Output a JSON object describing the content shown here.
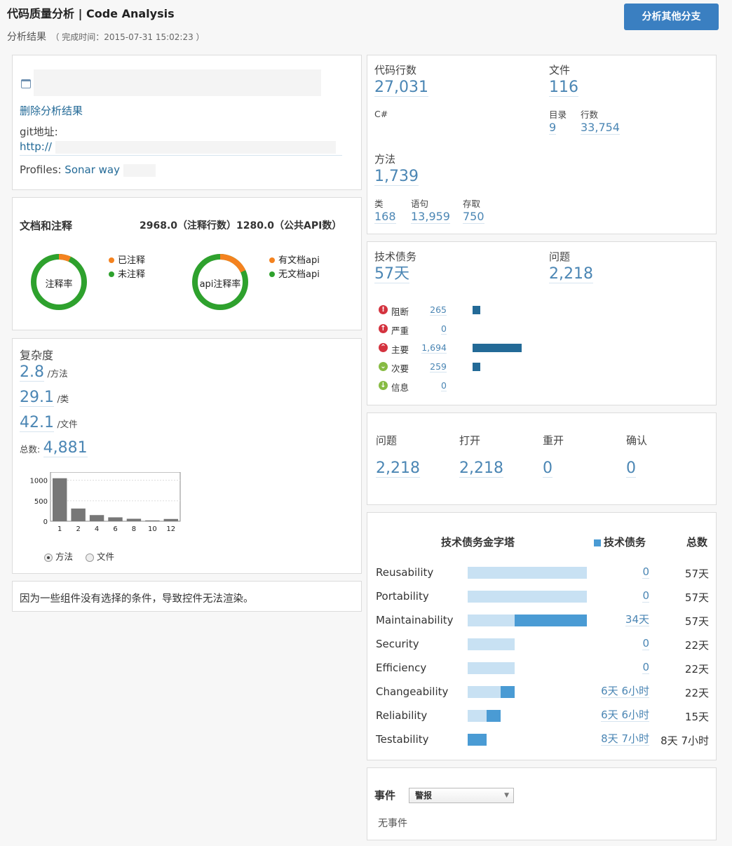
{
  "header": {
    "title": "代码质量分析 | Code Analysis",
    "subtitle": "分析结果",
    "completed": "（ 完成时间：2015-07-31 15:02:23 ）",
    "branch_button": "分析其他分支"
  },
  "project": {
    "delete_link": "删除分析结果",
    "git_label": "git地址:",
    "git_url": "http://",
    "profiles_label": "Profiles:",
    "profile_name": "Sonar way"
  },
  "docs": {
    "title": "文档和注释",
    "summary": "2968.0（注释行数）1280.0（公共API数）",
    "donut1": {
      "center": "注释率",
      "legend": [
        "已注释",
        "未注释"
      ],
      "fraction": 0.07
    },
    "donut2": {
      "center": "api注释率",
      "legend": [
        "有文档api",
        "无文档api"
      ],
      "fraction": 0.18
    },
    "colors": {
      "orange": "#f4821f",
      "green": "#2ea12d"
    }
  },
  "complexity": {
    "title": "复杂度",
    "per_method": "2.8",
    "per_method_unit": "/方法",
    "per_class": "29.1",
    "per_class_unit": "/类",
    "per_file": "42.1",
    "per_file_unit": "/文件",
    "total_label": "总数:",
    "total": "4,881",
    "radio_method": "方法",
    "radio_file": "文件"
  },
  "chart_data": {
    "type": "bar",
    "categories": [
      "1",
      "2",
      "4",
      "6",
      "8",
      "10",
      "12"
    ],
    "values": [
      1050,
      310,
      150,
      95,
      60,
      20,
      55
    ],
    "yticks": [
      "0",
      "500",
      "1000"
    ],
    "ylim": [
      0,
      1200
    ]
  },
  "notice": "因为一些组件没有选择的条件，导致控件无法渲染。",
  "metrics": {
    "loc_label": "代码行数",
    "loc": "27,031",
    "language": "C#",
    "files_label": "文件",
    "files": "116",
    "dirs_label": "目录",
    "dirs": "9",
    "lines_label": "行数",
    "lines": "33,754",
    "methods_label": "方法",
    "methods": "1,739",
    "classes_label": "类",
    "classes": "168",
    "statements_label": "语句",
    "statements": "13,959",
    "accessors_label": "存取",
    "accessors": "750"
  },
  "debt": {
    "debt_label": "技术债务",
    "debt": "57天",
    "issues_label": "问题",
    "issues": "2,218",
    "severities": [
      {
        "name": "阻断",
        "count": "265",
        "value": 265,
        "icon": "blocker-icon",
        "glyph": "!",
        "color": "#d4333f"
      },
      {
        "name": "严重",
        "count": "0",
        "value": 0,
        "icon": "critical-icon",
        "glyph": "↑",
        "color": "#d4333f"
      },
      {
        "name": "主要",
        "count": "1,694",
        "value": 1694,
        "icon": "major-icon",
        "glyph": "⌃",
        "color": "#d4333f"
      },
      {
        "name": "次要",
        "count": "259",
        "value": 259,
        "icon": "minor-icon",
        "glyph": "⌄",
        "color": "#87bb43"
      },
      {
        "name": "信息",
        "count": "0",
        "value": 0,
        "icon": "info-icon",
        "glyph": "↓",
        "color": "#87bb43"
      }
    ]
  },
  "issue_status": [
    {
      "label": "问题",
      "value": "2,218"
    },
    {
      "label": "打开",
      "value": "2,218"
    },
    {
      "label": "重开",
      "value": "0"
    },
    {
      "label": "确认",
      "value": "0"
    }
  ],
  "pyramid": {
    "title": "技术债务金字塔",
    "legend": "技术债务",
    "total_header": "总数",
    "rows": [
      {
        "name": "Reusability",
        "debt": "0",
        "total": "57天",
        "light": 1.0,
        "dark_start": 1.0,
        "dark_end": 1.0
      },
      {
        "name": "Portability",
        "debt": "0",
        "total": "57天",
        "light": 1.0,
        "dark_start": 1.0,
        "dark_end": 1.0
      },
      {
        "name": "Maintainability",
        "debt": "34天",
        "total": "57天",
        "light": 1.0,
        "dark_start": 0.395,
        "dark_end": 1.0
      },
      {
        "name": "Security",
        "debt": "0",
        "total": "22天",
        "light": 0.395,
        "dark_start": 0.395,
        "dark_end": 0.395
      },
      {
        "name": "Efficiency",
        "debt": "0",
        "total": "22天",
        "light": 0.395,
        "dark_start": 0.395,
        "dark_end": 0.395
      },
      {
        "name": "Changeability",
        "debt": "6天 6小时",
        "total": "22天",
        "light": 0.395,
        "dark_start": 0.277,
        "dark_end": 0.395
      },
      {
        "name": "Reliability",
        "debt": "6天 6小时",
        "total": "15天",
        "light": 0.277,
        "dark_start": 0.159,
        "dark_end": 0.277
      },
      {
        "name": "Testability",
        "debt": "8天 7小时",
        "total": "8天 7小时",
        "light": 0.159,
        "dark_start": 0.0,
        "dark_end": 0.159
      }
    ]
  },
  "events": {
    "title": "事件",
    "filter": "警报",
    "empty": "无事件"
  }
}
